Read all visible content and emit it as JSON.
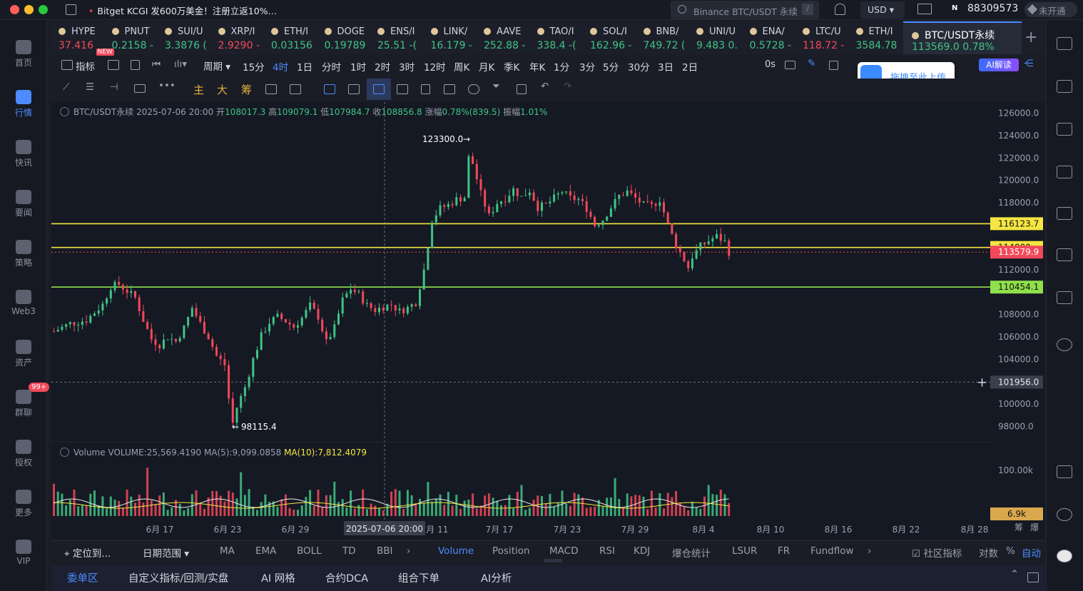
{
  "window": {
    "traffic_lights": [
      "#ff5f57",
      "#febc2e",
      "#28c840"
    ]
  },
  "topbar": {
    "promo": "Bitget KCGI 发600万美金！注册立返10%…",
    "search_placeholder": "Binance BTC/USDT 永续",
    "search_shortcut": "/",
    "currency": "USD",
    "account_id": "88309573",
    "account_badge": "N",
    "vip_status": "未开通"
  },
  "sidebar": {
    "items": [
      {
        "label": "首页",
        "icon": "home-icon"
      },
      {
        "label": "行情",
        "icon": "market-chart-icon",
        "active": true
      },
      {
        "label": "快讯",
        "icon": "flash-news-icon"
      },
      {
        "label": "要闻",
        "icon": "news-icon"
      },
      {
        "label": "策略",
        "icon": "strategy-robot-icon"
      },
      {
        "label": "Web3",
        "icon": "web3-icon"
      },
      {
        "label": "资产",
        "icon": "wallet-icon"
      },
      {
        "label": "群聊",
        "icon": "chat-icon",
        "badge": "99+"
      },
      {
        "label": "授权",
        "icon": "auth-icon"
      },
      {
        "label": "更多",
        "icon": "more-grid-icon"
      },
      {
        "label": "VIP",
        "icon": "vip-diamond-icon"
      }
    ]
  },
  "tickers": [
    {
      "symbol": "HYPE",
      "price": "37.416",
      "dir": "dn"
    },
    {
      "symbol": "PNUT",
      "price": "0.2158 -",
      "dir": "up",
      "badge": "NEW"
    },
    {
      "symbol": "SUI/U",
      "price": "3.3876 (",
      "dir": "up"
    },
    {
      "symbol": "XRP/I",
      "price": "2.9290 -",
      "dir": "dn"
    },
    {
      "symbol": "ETH/I",
      "price": "0.03156",
      "dir": "up"
    },
    {
      "symbol": "DOGE",
      "price": "0.19789",
      "dir": "up"
    },
    {
      "symbol": "ENS/I",
      "price": "25.51 -(",
      "dir": "up"
    },
    {
      "symbol": "LINK/",
      "price": "16.179 -",
      "dir": "up"
    },
    {
      "symbol": "AAVE",
      "price": "252.88 -",
      "dir": "up"
    },
    {
      "symbol": "TAO/I",
      "price": "338.4 -(",
      "dir": "up"
    },
    {
      "symbol": "SOL/I",
      "price": "162.96 -",
      "dir": "up"
    },
    {
      "symbol": "BNB/",
      "price": "749.72 (",
      "dir": "up"
    },
    {
      "symbol": "UNI/U",
      "price": "9.483 0.",
      "dir": "up"
    },
    {
      "symbol": "ENA/",
      "price": "0.5728 -",
      "dir": "up"
    },
    {
      "symbol": "LTC/U",
      "price": "118.72 -",
      "dir": "dn"
    },
    {
      "symbol": "ETH/I",
      "price": "3584.78",
      "dir": "up"
    }
  ],
  "active_ticker": {
    "symbol": "BTC/USDT永续",
    "price": "113569.0 0.78%"
  },
  "toolbar": {
    "indicator": "指标",
    "period": "周期",
    "intervals": [
      "15分",
      "4时",
      "1日",
      "分时",
      "1时",
      "2时",
      "3时",
      "12时",
      "周K",
      "月K",
      "季K",
      "年K",
      "1分",
      "3分",
      "5分",
      "30分",
      "3日",
      "2日"
    ],
    "selected_interval": "4时",
    "countdown": "0s",
    "ai_button": "AI解读",
    "upload_tip": "拖拽至此上传",
    "drawing_tools": [
      "主",
      "大",
      "筹"
    ]
  },
  "legend": {
    "text": "BTC/USDT永续 2025-07-06 20:00",
    "open_label": "开",
    "open": "108017.3",
    "high_label": "高",
    "high": "109079.1",
    "low_label": "低",
    "low": "107984.7",
    "close_label": "收",
    "close": "108856.8",
    "change_label": "涨幅",
    "change": "0.78%(839.5)",
    "amp_label": "振幅",
    "amp": "1.01%"
  },
  "volume_legend": {
    "name": "Volume",
    "vol": "VOLUME:25,569.4190",
    "ma5": "MA(5):9,099.0858",
    "ma10": "MA(10):7,812.4079"
  },
  "chart_data": {
    "type": "candlestick",
    "y_ticks": [
      "126000.0",
      "124000.0",
      "122000.0",
      "120000.0",
      "118000.0",
      "112000.0",
      "108000.0",
      "106000.0",
      "104000.0",
      "100000.0",
      "98000.0"
    ],
    "ylim": [
      97000,
      127000
    ],
    "x_ticks": [
      "6月 17",
      "6月 23",
      "6月 29",
      "7月 11",
      "7月 17",
      "7月 23",
      "7月 29",
      "8月 4",
      "8月 10",
      "8月 16",
      "8月 22",
      "8月 28"
    ],
    "crosshair_date": "2025-07-06 20:00",
    "crosshair_price": "101956.0",
    "annotations": {
      "high": "123300.0",
      "low": "98115.4"
    },
    "horizontal_lines": [
      {
        "price": 116123.7,
        "label": "116123.7",
        "color": "#f5e642"
      },
      {
        "price": 114000,
        "label": "114000",
        "color": "#f5e642"
      },
      {
        "price": 110454.1,
        "label": "110454.1",
        "color": "#8fe04a"
      }
    ],
    "last_price": {
      "label": "113579.9",
      "value": 113579.9
    },
    "volume_ticks": [
      "100.00k"
    ],
    "volume_last": "6.9k",
    "path_points": [
      [
        0,
        106500
      ],
      [
        4,
        107200
      ],
      [
        8,
        107500
      ],
      [
        12,
        108900
      ],
      [
        14,
        110500
      ],
      [
        16,
        110700
      ],
      [
        18,
        110100
      ],
      [
        20,
        109500
      ],
      [
        22,
        107500
      ],
      [
        24,
        105800
      ],
      [
        26,
        105300
      ],
      [
        28,
        106000
      ],
      [
        30,
        105600
      ],
      [
        32,
        106800
      ],
      [
        34,
        108600
      ],
      [
        36,
        107200
      ],
      [
        38,
        106000
      ],
      [
        40,
        104300
      ],
      [
        42,
        103500
      ],
      [
        43,
        100500
      ],
      [
        44,
        98300
      ],
      [
        45,
        99700
      ],
      [
        47,
        101500
      ],
      [
        49,
        104000
      ],
      [
        51,
        106100
      ],
      [
        53,
        107300
      ],
      [
        55,
        107800
      ],
      [
        57,
        107400
      ],
      [
        59,
        106900
      ],
      [
        61,
        107700
      ],
      [
        63,
        108800
      ],
      [
        65,
        107800
      ],
      [
        67,
        105500
      ],
      [
        69,
        106800
      ],
      [
        71,
        109300
      ],
      [
        73,
        110300
      ],
      [
        75,
        109800
      ],
      [
        77,
        108800
      ],
      [
        79,
        108400
      ],
      [
        81,
        108700
      ],
      [
        83,
        108900
      ],
      [
        85,
        108300
      ],
      [
        87,
        108600
      ],
      [
        89,
        109100
      ],
      [
        91,
        112000
      ],
      [
        93,
        116500
      ],
      [
        95,
        117500
      ],
      [
        97,
        117800
      ],
      [
        99,
        118300
      ],
      [
        101,
        118500
      ],
      [
        102,
        122000
      ],
      [
        103,
        121500
      ],
      [
        105,
        118800
      ],
      [
        107,
        116800
      ],
      [
        109,
        118000
      ],
      [
        111,
        118400
      ],
      [
        113,
        119200
      ],
      [
        115,
        118500
      ],
      [
        117,
        119100
      ],
      [
        119,
        117600
      ],
      [
        121,
        117800
      ],
      [
        123,
        118400
      ],
      [
        125,
        119000
      ],
      [
        127,
        118400
      ],
      [
        129,
        118300
      ],
      [
        131,
        117500
      ],
      [
        133,
        116000
      ],
      [
        135,
        116500
      ],
      [
        137,
        117600
      ],
      [
        139,
        118600
      ],
      [
        141,
        119000
      ],
      [
        143,
        118400
      ],
      [
        145,
        117800
      ],
      [
        147,
        117700
      ],
      [
        149,
        118300
      ],
      [
        151,
        116000
      ],
      [
        153,
        114200
      ],
      [
        155,
        112900
      ],
      [
        156,
        112200
      ],
      [
        157,
        113200
      ],
      [
        159,
        114100
      ],
      [
        161,
        114600
      ],
      [
        163,
        115000
      ],
      [
        165,
        114500
      ],
      [
        166,
        113580
      ]
    ]
  },
  "crosshair_tools": {
    "plus_icon": "crosshair-plus-icon"
  },
  "bottom_bar": {
    "locate": "定位到...",
    "date_range": "日期范围",
    "overlays": [
      "MA",
      "EMA",
      "BOLL",
      "TD",
      "BBI"
    ],
    "sub_indicators": [
      "Volume",
      "Position",
      "MACD",
      "RSI",
      "KDJ",
      "爆仓统计",
      "LSUR",
      "FR",
      "Fundflow"
    ],
    "active_sub": "Volume",
    "community": "社区指标",
    "log": "对数",
    "percent": "%",
    "auto": "自动",
    "corner_labels": [
      "筹",
      "爆"
    ]
  },
  "bottom_tabs": [
    "委单区",
    "自定义指标/回测/实盘",
    "AI 网格",
    "合约DCA",
    "组合下单",
    "AI分析"
  ],
  "colors": {
    "up": "#3fc486",
    "down": "#f2495b",
    "accent": "#4d8bff",
    "background": "#151923"
  }
}
